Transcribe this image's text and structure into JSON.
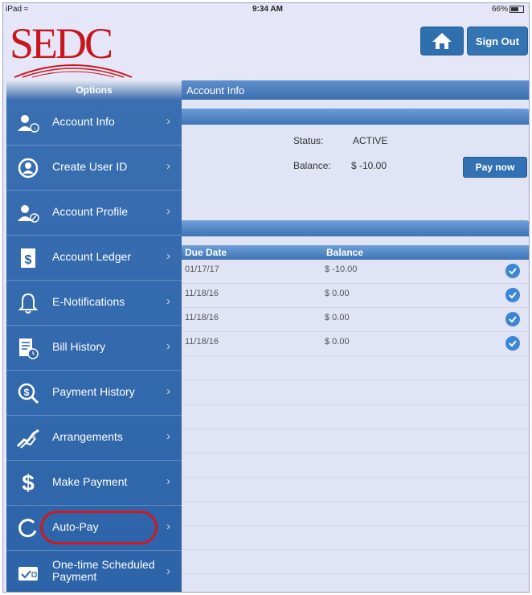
{
  "status_bar": {
    "device": "iPad",
    "time": "9:34 AM",
    "battery": "66%"
  },
  "header": {
    "logo_text": "SEDC",
    "home_icon": "home-icon",
    "sign_out": "Sign Out"
  },
  "sidebar": {
    "title": "Options",
    "items": [
      {
        "label": "Account Info",
        "icon": "user-info-icon"
      },
      {
        "label": "Create User ID",
        "icon": "user-circle-icon"
      },
      {
        "label": "Account Profile",
        "icon": "user-edit-icon"
      },
      {
        "label": "Account Ledger",
        "icon": "ledger-dollar-icon"
      },
      {
        "label": "E-Notifications",
        "icon": "bell-icon"
      },
      {
        "label": "Bill History",
        "icon": "bill-clock-icon"
      },
      {
        "label": "Payment History",
        "icon": "dollar-search-icon"
      },
      {
        "label": "Arrangements",
        "icon": "handshake-icon"
      },
      {
        "label": "Make Payment",
        "icon": "dollar-icon"
      },
      {
        "label": "Auto-Pay",
        "icon": "auto-pay-icon"
      },
      {
        "label": "One-time Scheduled Payment",
        "icon": "card-check-icon"
      }
    ],
    "highlight_color": "#d0181f"
  },
  "main": {
    "title": "Account Info",
    "status_label": "Status:",
    "status_value": "ACTIVE",
    "balance_label": "Balance:",
    "balance_value": "$ -10.00",
    "pay_now": "Pay now",
    "table": {
      "headers": [
        "Due Date",
        "Balance"
      ],
      "rows": [
        {
          "due": "01/17/17",
          "balance": "$ -10.00"
        },
        {
          "due": "11/18/16",
          "balance": "$ 0.00"
        },
        {
          "due": "11/18/16",
          "balance": "$ 0.00"
        },
        {
          "due": "11/18/16",
          "balance": "$ 0.00"
        }
      ]
    }
  },
  "colors": {
    "sidebar": "#2d63a8",
    "accent": "#3272b2",
    "brand_red": "#c9161d"
  }
}
